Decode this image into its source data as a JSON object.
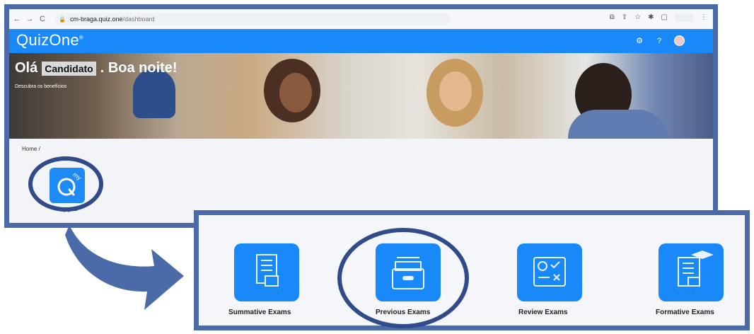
{
  "browser": {
    "url_host": "cm-braga.quiz.one",
    "url_path": "/dashboard"
  },
  "app": {
    "logo_text": "QuizOne",
    "logo_mark": "®"
  },
  "banner": {
    "greeting_prefix": "Olá",
    "candidate_name": "Candidato",
    "greeting_suffix": ". Boa noite!",
    "subtitle": "Descubra os benefícios"
  },
  "breadcrumb": "Home /",
  "tile": {
    "label": "myQuiz",
    "badge": "my"
  },
  "exam_cards": [
    {
      "label": "Summative Exams",
      "icon": "checklist-grade-icon"
    },
    {
      "label": "Previous Exams",
      "icon": "archive-box-icon"
    },
    {
      "label": "Review Exams",
      "icon": "review-checks-icon"
    },
    {
      "label": "Formative Exams",
      "icon": "graduation-checklist-icon"
    }
  ],
  "colors": {
    "accent": "#1989fa",
    "annotation": "#4a6aa8"
  }
}
